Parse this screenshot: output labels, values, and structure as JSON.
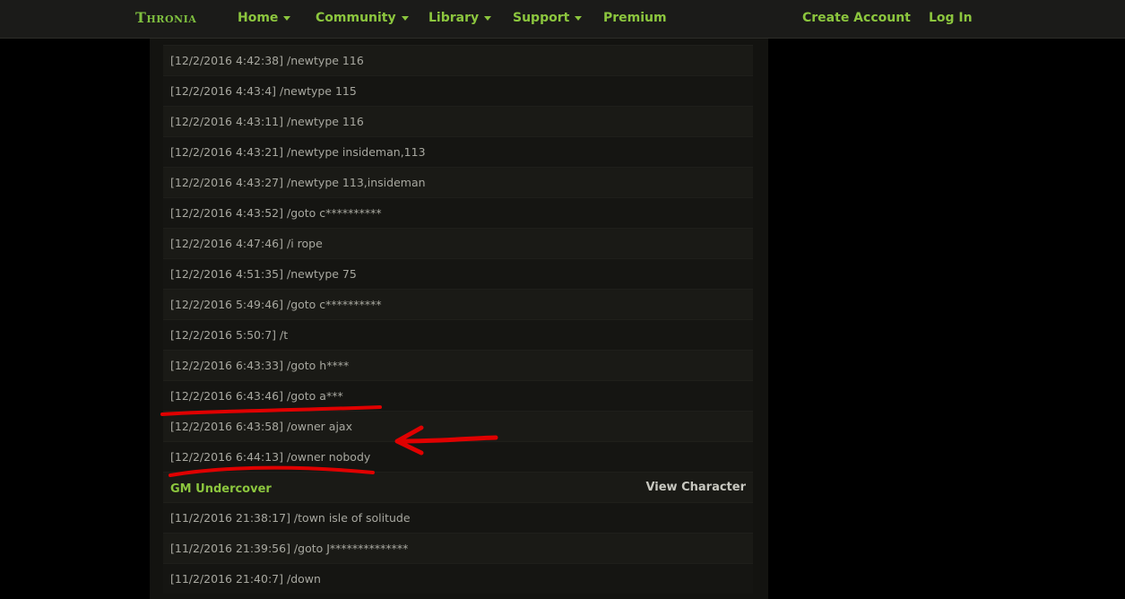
{
  "nav": {
    "logo": "Thronia",
    "items": [
      {
        "label": "Home",
        "dropdown": true
      },
      {
        "label": "Community",
        "dropdown": true
      },
      {
        "label": "Library",
        "dropdown": true
      },
      {
        "label": "Support",
        "dropdown": true
      },
      {
        "label": "Premium",
        "dropdown": false
      }
    ],
    "create_account": "Create Account",
    "log_in": "Log In"
  },
  "log_entries": [
    "[12/2/2016 4:42:38] /newtype 116",
    "[12/2/2016 4:43:4] /newtype 115",
    "[12/2/2016 4:43:11] /newtype 116",
    "[12/2/2016 4:43:21] /newtype insideman,113",
    "[12/2/2016 4:43:27] /newtype 113,insideman",
    "[12/2/2016 4:43:52] /goto c**********",
    "[12/2/2016 4:47:46] /i rope",
    "[12/2/2016 4:51:35] /newtype 75",
    "[12/2/2016 5:49:46] /goto c**********",
    "[12/2/2016 5:50:7] /t",
    "[12/2/2016 6:43:33] /goto h****",
    "[12/2/2016 6:43:46] /goto a***",
    "[12/2/2016 6:43:58] /owner ajax",
    "[12/2/2016 6:44:13] /owner nobody"
  ],
  "section": {
    "title": "GM Undercover",
    "link": "View Character"
  },
  "section_entries": [
    "[11/2/2016 21:38:17] /town isle of solitude",
    "[11/2/2016 21:39:56] /goto J**************",
    "[11/2/2016 21:40:7] /down"
  ],
  "colors": {
    "accent": "#8cc63e",
    "annotation": "#e00000",
    "background": "#000000",
    "panel": "#131310"
  }
}
